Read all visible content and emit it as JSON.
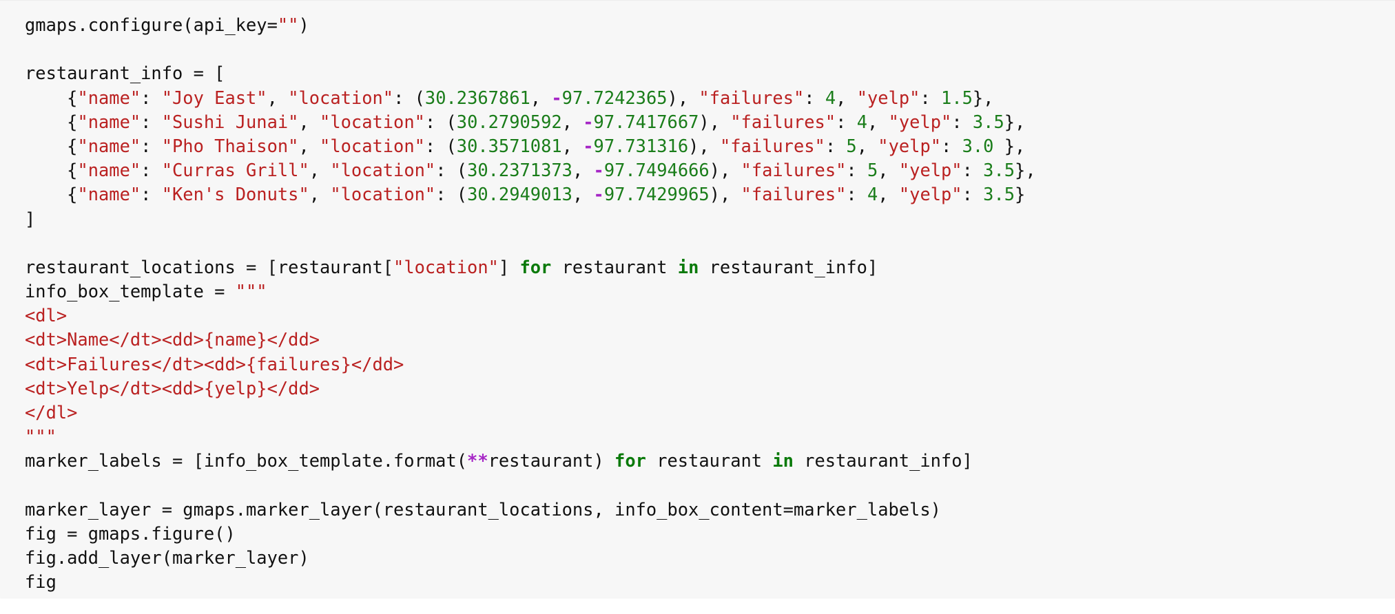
{
  "code_cell": {
    "lines": [
      [
        [
          "p",
          "gmaps.configure(api_key="
        ],
        [
          "s",
          "\"\""
        ],
        [
          "p",
          ")"
        ]
      ],
      [],
      [
        [
          "p",
          "restaurant_info = ["
        ]
      ],
      [
        [
          "p",
          "    {"
        ],
        [
          "s",
          "\"name\""
        ],
        [
          "p",
          ": "
        ],
        [
          "s",
          "\"Joy East\""
        ],
        [
          "p",
          ", "
        ],
        [
          "s",
          "\"location\""
        ],
        [
          "p",
          ": ("
        ],
        [
          "n",
          "30.2367861"
        ],
        [
          "p",
          ", "
        ],
        [
          "o",
          "-"
        ],
        [
          "n",
          "97.7242365"
        ],
        [
          "p",
          "), "
        ],
        [
          "s",
          "\"failures\""
        ],
        [
          "p",
          ": "
        ],
        [
          "n",
          "4"
        ],
        [
          "p",
          ", "
        ],
        [
          "s",
          "\"yelp\""
        ],
        [
          "p",
          ": "
        ],
        [
          "n",
          "1.5"
        ],
        [
          "p",
          "},"
        ]
      ],
      [
        [
          "p",
          "    {"
        ],
        [
          "s",
          "\"name\""
        ],
        [
          "p",
          ": "
        ],
        [
          "s",
          "\"Sushi Junai\""
        ],
        [
          "p",
          ", "
        ],
        [
          "s",
          "\"location\""
        ],
        [
          "p",
          ": ("
        ],
        [
          "n",
          "30.2790592"
        ],
        [
          "p",
          ", "
        ],
        [
          "o",
          "-"
        ],
        [
          "n",
          "97.7417667"
        ],
        [
          "p",
          "), "
        ],
        [
          "s",
          "\"failures\""
        ],
        [
          "p",
          ": "
        ],
        [
          "n",
          "4"
        ],
        [
          "p",
          ", "
        ],
        [
          "s",
          "\"yelp\""
        ],
        [
          "p",
          ": "
        ],
        [
          "n",
          "3.5"
        ],
        [
          "p",
          "},"
        ]
      ],
      [
        [
          "p",
          "    {"
        ],
        [
          "s",
          "\"name\""
        ],
        [
          "p",
          ": "
        ],
        [
          "s",
          "\"Pho Thaison\""
        ],
        [
          "p",
          ", "
        ],
        [
          "s",
          "\"location\""
        ],
        [
          "p",
          ": ("
        ],
        [
          "n",
          "30.3571081"
        ],
        [
          "p",
          ", "
        ],
        [
          "o",
          "-"
        ],
        [
          "n",
          "97.731316"
        ],
        [
          "p",
          "), "
        ],
        [
          "s",
          "\"failures\""
        ],
        [
          "p",
          ": "
        ],
        [
          "n",
          "5"
        ],
        [
          "p",
          ", "
        ],
        [
          "s",
          "\"yelp\""
        ],
        [
          "p",
          ": "
        ],
        [
          "n",
          "3.0"
        ],
        [
          "p",
          " },"
        ]
      ],
      [
        [
          "p",
          "    {"
        ],
        [
          "s",
          "\"name\""
        ],
        [
          "p",
          ": "
        ],
        [
          "s",
          "\"Curras Grill\""
        ],
        [
          "p",
          ", "
        ],
        [
          "s",
          "\"location\""
        ],
        [
          "p",
          ": ("
        ],
        [
          "n",
          "30.2371373"
        ],
        [
          "p",
          ", "
        ],
        [
          "o",
          "-"
        ],
        [
          "n",
          "97.7494666"
        ],
        [
          "p",
          "), "
        ],
        [
          "s",
          "\"failures\""
        ],
        [
          "p",
          ": "
        ],
        [
          "n",
          "5"
        ],
        [
          "p",
          ", "
        ],
        [
          "s",
          "\"yelp\""
        ],
        [
          "p",
          ": "
        ],
        [
          "n",
          "3.5"
        ],
        [
          "p",
          "},"
        ]
      ],
      [
        [
          "p",
          "    {"
        ],
        [
          "s",
          "\"name\""
        ],
        [
          "p",
          ": "
        ],
        [
          "s",
          "\"Ken's Donuts\""
        ],
        [
          "p",
          ", "
        ],
        [
          "s",
          "\"location\""
        ],
        [
          "p",
          ": ("
        ],
        [
          "n",
          "30.2949013"
        ],
        [
          "p",
          ", "
        ],
        [
          "o",
          "-"
        ],
        [
          "n",
          "97.7429965"
        ],
        [
          "p",
          "), "
        ],
        [
          "s",
          "\"failures\""
        ],
        [
          "p",
          ": "
        ],
        [
          "n",
          "4"
        ],
        [
          "p",
          ", "
        ],
        [
          "s",
          "\"yelp\""
        ],
        [
          "p",
          ": "
        ],
        [
          "n",
          "3.5"
        ],
        [
          "p",
          "}"
        ]
      ],
      [
        [
          "p",
          "]"
        ]
      ],
      [],
      [
        [
          "p",
          "restaurant_locations = [restaurant["
        ],
        [
          "s",
          "\"location\""
        ],
        [
          "p",
          "] "
        ],
        [
          "k",
          "for"
        ],
        [
          "p",
          " restaurant "
        ],
        [
          "k",
          "in"
        ],
        [
          "p",
          " restaurant_info]"
        ]
      ],
      [
        [
          "p",
          "info_box_template = "
        ],
        [
          "s",
          "\"\"\""
        ]
      ],
      [
        [
          "s",
          "<dl>"
        ]
      ],
      [
        [
          "s",
          "<dt>Name</dt><dd>{name}</dd>"
        ]
      ],
      [
        [
          "s",
          "<dt>Failures</dt><dd>{failures}</dd>"
        ]
      ],
      [
        [
          "s",
          "<dt>Yelp</dt><dd>{yelp}</dd>"
        ]
      ],
      [
        [
          "s",
          "</dl>"
        ]
      ],
      [
        [
          "s",
          "\"\"\""
        ]
      ],
      [
        [
          "p",
          "marker_labels = [info_box_template.format("
        ],
        [
          "o",
          "**"
        ],
        [
          "p",
          "restaurant) "
        ],
        [
          "k",
          "for"
        ],
        [
          "p",
          " restaurant "
        ],
        [
          "k",
          "in"
        ],
        [
          "p",
          " restaurant_info]"
        ]
      ],
      [],
      [
        [
          "p",
          "marker_layer = gmaps.marker_layer(restaurant_locations, info_box_content=marker_labels)"
        ]
      ],
      [
        [
          "p",
          "fig = gmaps.figure()"
        ]
      ],
      [
        [
          "p",
          "fig.add_layer(marker_layer)"
        ]
      ],
      [
        [
          "p",
          "fig"
        ]
      ]
    ]
  },
  "colors": {
    "background": "#f7f7f7",
    "plain": "#111111",
    "string": "#ba2121",
    "number": "#1a7d1a",
    "keyword": "#0b7a0b",
    "operator": "#a626c6"
  }
}
